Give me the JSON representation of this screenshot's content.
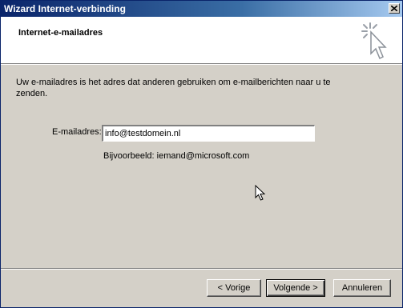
{
  "window": {
    "title": "Wizard Internet-verbinding",
    "close_icon": "close-icon"
  },
  "header": {
    "title": "Internet-e-mailadres",
    "icon": "wizard-sparkle-cursor-icon"
  },
  "content": {
    "intro": "Uw e-mailadres is het adres dat anderen gebruiken om e-mailberichten naar u te zenden.",
    "email_label": "E-mailadres:",
    "email_value": "info@testdomein.nl",
    "example": "Bijvoorbeeld: iemand@microsoft.com"
  },
  "buttons": {
    "back": "< Vorige",
    "next": "Volgende >",
    "cancel": "Annuleren"
  },
  "colors": {
    "titlebar_start": "#0a246a",
    "titlebar_end": "#a6caf0",
    "face": "#d4d0c8"
  }
}
